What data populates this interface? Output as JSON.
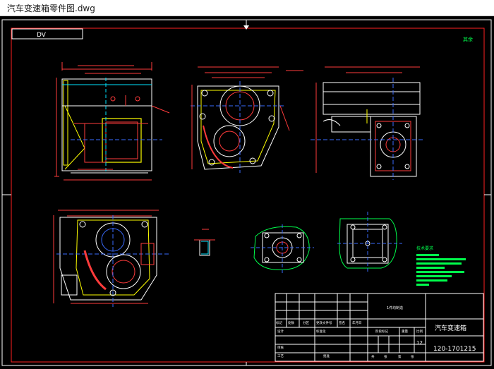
{
  "window": {
    "title": "汽车变速箱零件图.dwg"
  },
  "drawing": {
    "corner_label": "DV",
    "top_right_mark": "其余",
    "tech_requirements_title": "技术要求",
    "title_block": {
      "product_name": "汽车变速箱",
      "drawing_number": "120-1701215",
      "center_label": "1件均制造",
      "sheet_count": "12",
      "header_cells": [
        "标记",
        "处数",
        "分区",
        "更改文件号",
        "签名",
        "年月日"
      ],
      "row_labels": [
        "设计",
        "审核",
        "工艺"
      ],
      "mid_labels": [
        "标准化",
        "批准"
      ],
      "stage_labels": [
        "阶段标记",
        "重量",
        "比例"
      ],
      "sheet_labels": [
        "共",
        "张",
        "第",
        "张"
      ]
    },
    "colors": {
      "border": "#ffffff",
      "frame_red": "#ff2020",
      "geometry": "#ff3b3b",
      "cyan": "#00e5ff",
      "blue": "#3a6bff",
      "yellow": "#ffff00",
      "green": "#00ff4c",
      "white": "#ffffff"
    }
  }
}
